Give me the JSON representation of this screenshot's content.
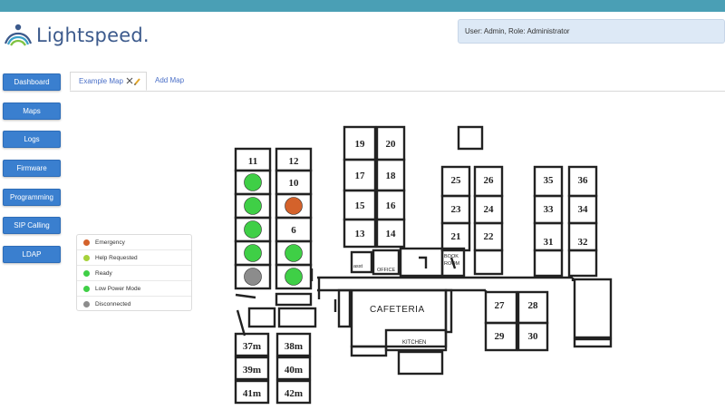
{
  "app": {
    "brand": "Lightspeed.",
    "brand_color": "#3c5a8c"
  },
  "header": {
    "user_info": "User: Admin, Role: Administrator"
  },
  "nav": {
    "items": [
      {
        "label": "Dashboard"
      },
      {
        "label": "Maps"
      },
      {
        "label": "Logs"
      },
      {
        "label": "Firmware"
      },
      {
        "label": "Programming"
      },
      {
        "label": "SIP Calling"
      },
      {
        "label": "LDAP"
      }
    ]
  },
  "tabs": {
    "active": "Example Map",
    "add": "Add Map",
    "icons": [
      "close-icon",
      "edit-pencil-icon"
    ]
  },
  "legend": [
    {
      "label": "Emergency",
      "color": "#d4622b"
    },
    {
      "label": "Help Requested",
      "color": "#a6d23b"
    },
    {
      "label": "Ready",
      "color": "#3fcf46"
    },
    {
      "label": "Low Power Mode",
      "color": "#3fcf46"
    },
    {
      "label": "Disconnected",
      "color": "#8c8c8c"
    }
  ],
  "map": {
    "rooms": {
      "r11": "11",
      "r12": "12",
      "r10": "10",
      "r6": "6",
      "r19": "19",
      "r20": "20",
      "r17": "17",
      "r18": "18",
      "r15": "15",
      "r16": "16",
      "r13": "13",
      "r14": "14",
      "r25": "25",
      "r26": "26",
      "r23": "23",
      "r24": "24",
      "r21": "21",
      "r22": "22",
      "r35": "35",
      "r36": "36",
      "r33": "33",
      "r34": "34",
      "r31": "31",
      "r32": "32",
      "r27": "27",
      "r28": "28",
      "r29": "29",
      "r30": "30",
      "r37m": "37m",
      "r38m": "38m",
      "r39m": "39m",
      "r40m": "40m",
      "r41m": "41m",
      "r42m": "42m"
    },
    "labels": {
      "cafeteria": "CAFETERIA",
      "kitchen": "KITCHEN",
      "office": "OFFICE",
      "asst": "asst",
      "book": "BOOK",
      "room": "ROOM"
    },
    "status_markers": [
      {
        "room": "row-1-left",
        "status": "Ready"
      },
      {
        "room": "row-2-left",
        "status": "Ready"
      },
      {
        "room": "row-2-right",
        "status": "Emergency"
      },
      {
        "room": "row-3-left",
        "status": "Ready"
      },
      {
        "room": "row-4-left",
        "status": "Ready"
      },
      {
        "room": "row-4-right",
        "status": "Ready"
      },
      {
        "room": "row-5-left",
        "status": "Disconnected"
      },
      {
        "room": "row-5-right",
        "status": "Ready"
      }
    ]
  }
}
